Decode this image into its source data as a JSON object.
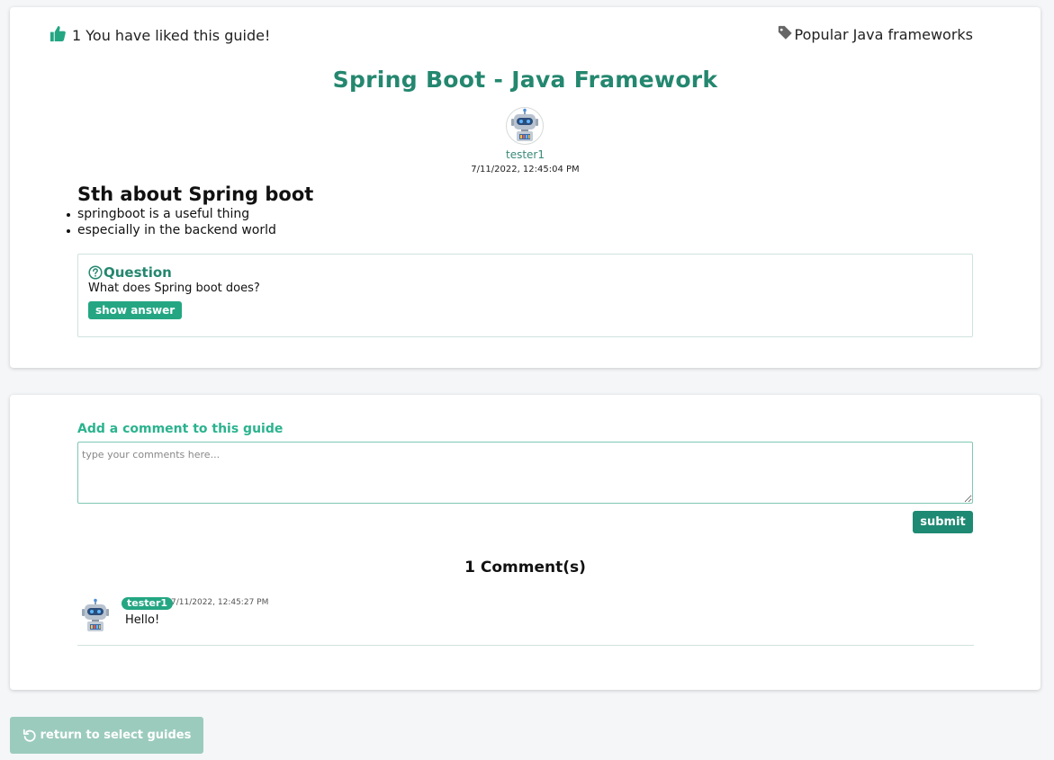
{
  "guide": {
    "likes_text": "1 You have liked this guide!",
    "tag_label": "Popular Java frameworks",
    "title": "Spring Boot - Java Framework",
    "author": "tester1",
    "date": "7/11/2022, 12:45:04 PM",
    "section_heading": "Sth about Spring boot",
    "bullets": [
      "springboot is a useful thing",
      "especially in the backend world"
    ],
    "question": {
      "label": "Question",
      "text": "What does Spring boot does?",
      "button_label": "show answer"
    }
  },
  "comment_form": {
    "label": "Add a comment to this guide",
    "placeholder": "type your comments here...",
    "value": "",
    "submit_label": "submit"
  },
  "comments": {
    "count_label": "1 Comment(s)",
    "items": [
      {
        "user": "tester1",
        "date": "7/11/2022, 12:45:27 PM",
        "text": "Hello!"
      }
    ]
  },
  "footer": {
    "return_label": "return to select guides"
  },
  "colors": {
    "brand_green": "#24876f",
    "accent_green": "#24a683",
    "return_button": "#9bcbbd"
  },
  "icons": {
    "like": "thumbs-up-icon",
    "tag": "tag-icon",
    "question": "question-circle-icon",
    "avatar": "robot-avatar-icon",
    "return": "undo-arrow-icon"
  }
}
